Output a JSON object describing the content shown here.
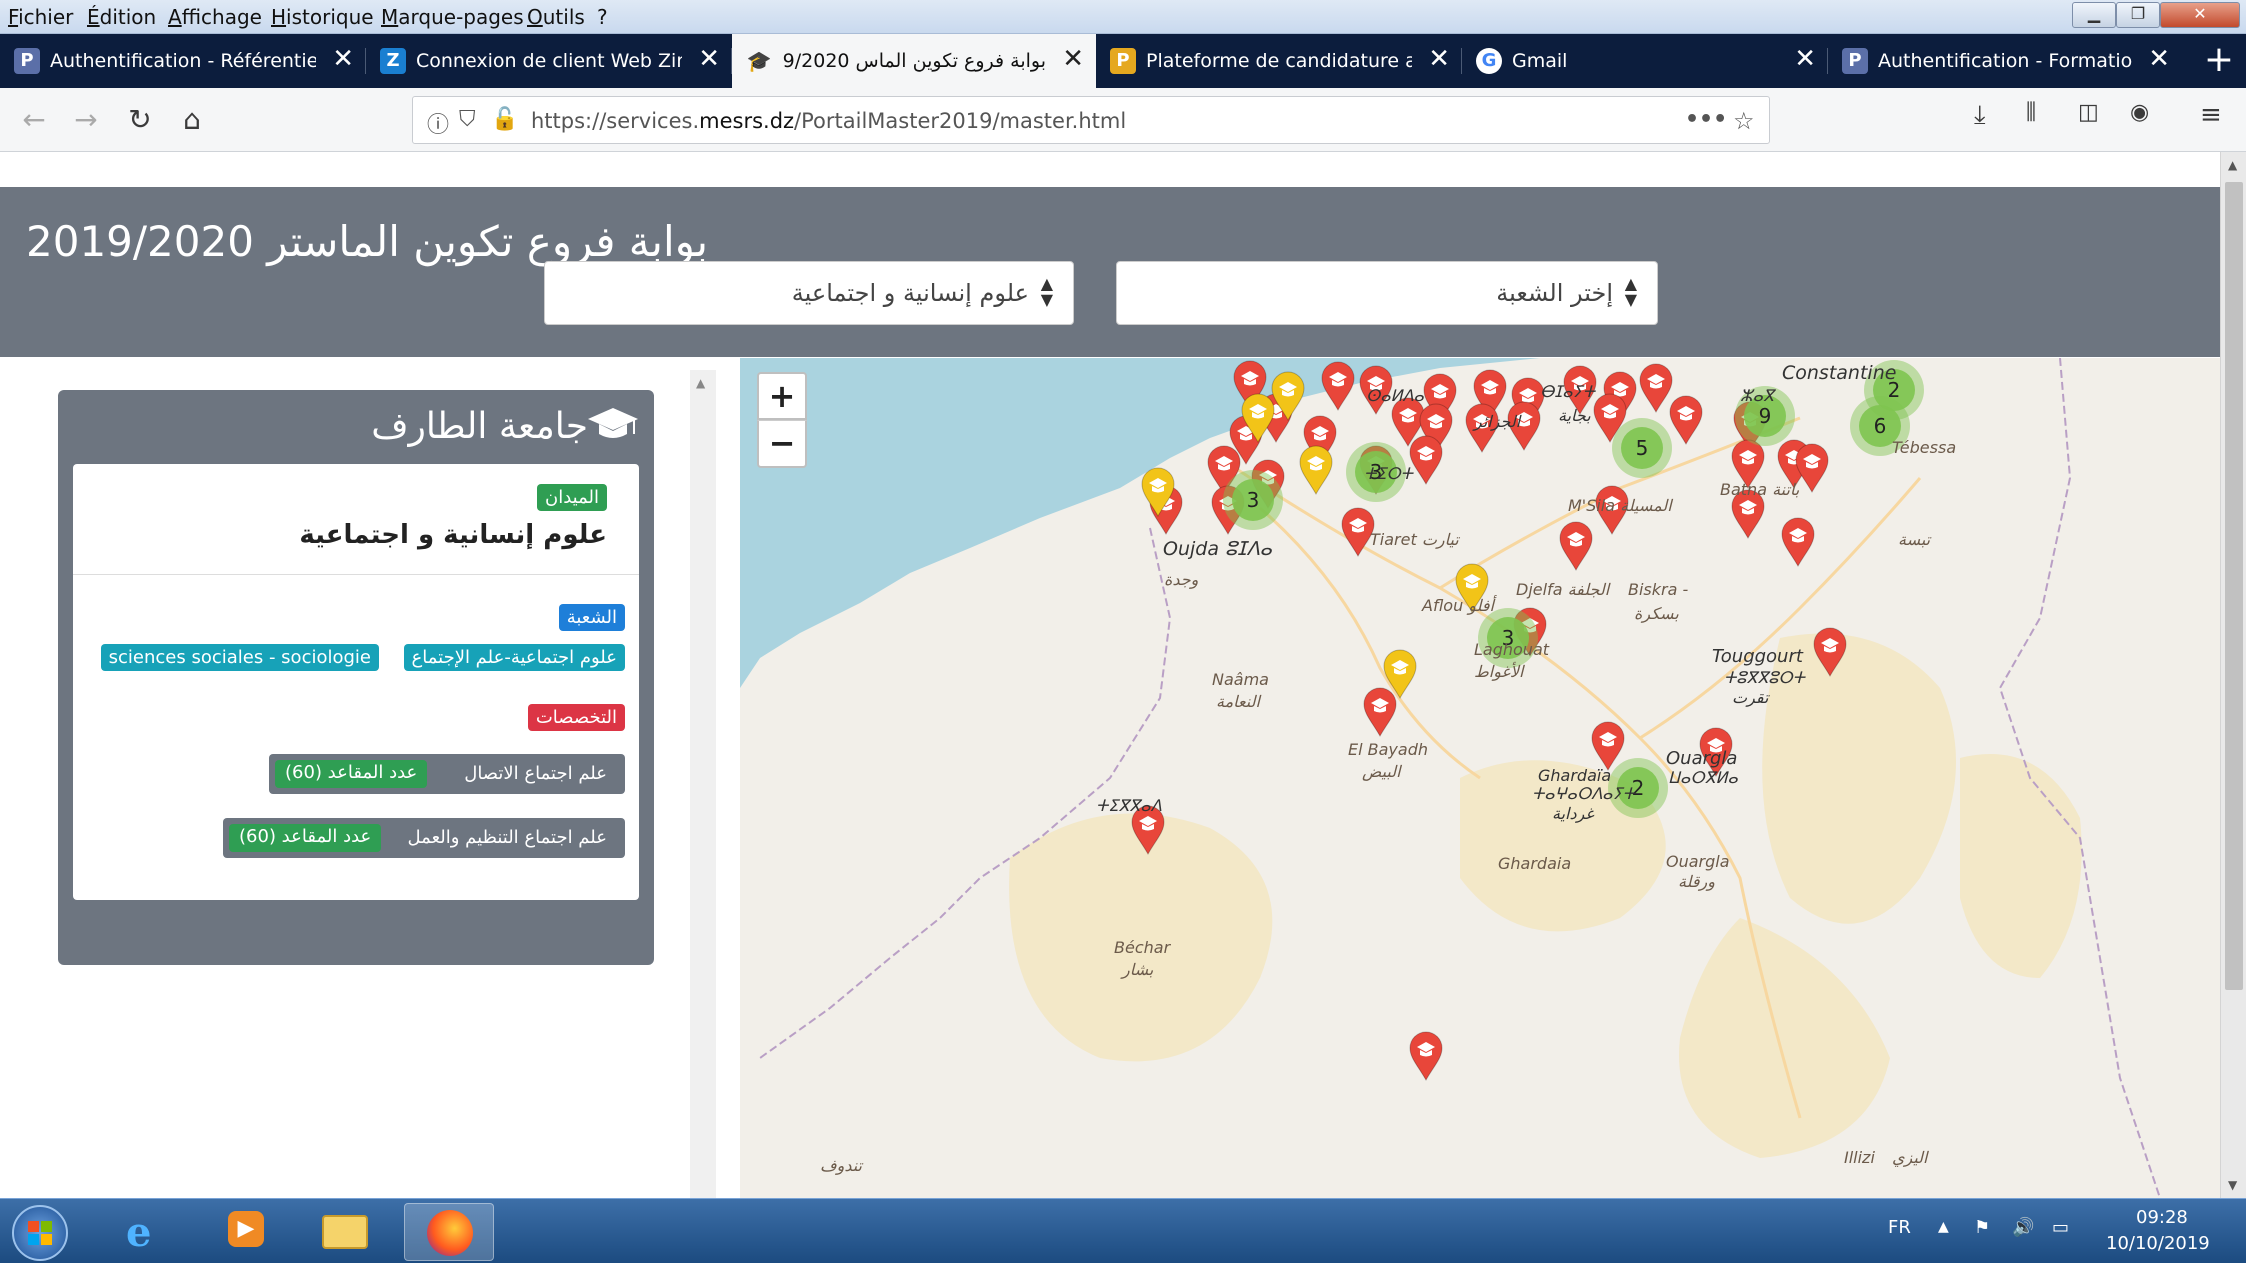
{
  "menu": [
    "Fichier",
    "Édition",
    "Affichage",
    "Historique",
    "Marque-pages",
    "Outils",
    "?"
  ],
  "tabs": [
    {
      "label": "Authentification - Référentiel c",
      "icon": "P"
    },
    {
      "label": "Connexion de client Web Zimb",
      "icon": "Z"
    },
    {
      "label": "بوابة فروع تكوين الماس 2019/2020",
      "icon": "mortarboard-icon"
    },
    {
      "label": "Plateforme de candidature au",
      "icon": "P"
    },
    {
      "label": "Gmail",
      "icon": "G"
    },
    {
      "label": "Authentification - Formation e",
      "icon": "P"
    }
  ],
  "url": {
    "prefix": "https://services.",
    "domain": "mesrs.dz",
    "path": "/PortailMaster2019/master.html"
  },
  "page": {
    "title": "بوابة فروع تكوين الماستر 2019/2020",
    "select_domain": "علوم إنسانية و اجتماعية",
    "select_branch": "إختر الشعبة"
  },
  "panel": {
    "university": "جامعة الطارف",
    "field_badge": "الميدان",
    "field_name": "علوم إنسانية و اجتماعية",
    "branch_badge": "الشعبة",
    "branch_ar": "علوم اجتماعية-علم الإجتماع",
    "branch_fr": "sciences sociales - sociologie",
    "specs_badge": "التخصصات",
    "specs": [
      {
        "name": "علم اجتماع الاتصال",
        "count": "عدد المقاعد (60)"
      },
      {
        "name": "علم اجتماع التنظيم والعمل",
        "count": "عدد المقاعد (60)"
      }
    ]
  },
  "map": {
    "zoom_in": "+",
    "zoom_out": "−",
    "labels": [
      "Constantine",
      "Oujda ⵓⵊⴷⴰ",
      "وجدة",
      "Tiaret تيارت",
      "M'Sila المسيلة",
      "Batna باتنة",
      "Tébessa",
      "تبسة",
      "Djelfa الجلفة",
      "Biskra -",
      "بسكرة",
      "Aflou أفلو",
      "Laghouat",
      "الأغواط",
      "Naâma",
      "النعامة",
      "El Bayadh",
      "البيض",
      "Touggourt",
      "ⵜⵓⴳⴳⵓⵔⵜ",
      "تقرت",
      "Ouargla",
      "ⵡⴰⵔⴳⵍⴰ",
      "Ghardaïa",
      "ⵜⴰⵖⴰⵔⴷⴰⵢⵜ",
      "غرداية",
      "Ghardaia",
      "Ouargla",
      "ورقلة",
      "Béchar",
      "بشار",
      "ⵜⵉⴳⴳⴰⴷ",
      "Illizi",
      "اليزي",
      "تندوف",
      "ⵜⵉⵔⵜ",
      "ⵣⴰⴳ",
      "ⴱⵊⴰⵢⵜ",
      "بجاية",
      "الجزائر",
      "ⵙⴰⵍⴷⴰ"
    ],
    "clusters": [
      3,
      3,
      5,
      9,
      6,
      3,
      2,
      2
    ]
  },
  "taskbar": {
    "lang": "FR",
    "time": "09:28",
    "date": "10/10/2019"
  },
  "colors": {
    "header": "#6d7580",
    "green": "#2f9e53",
    "blue": "#1e7fd9",
    "red": "#dc3545",
    "teal": "#17a2b8",
    "marker_red": "#e8463a",
    "marker_yellow": "#f2c418",
    "cluster_green": "#7ec450"
  }
}
